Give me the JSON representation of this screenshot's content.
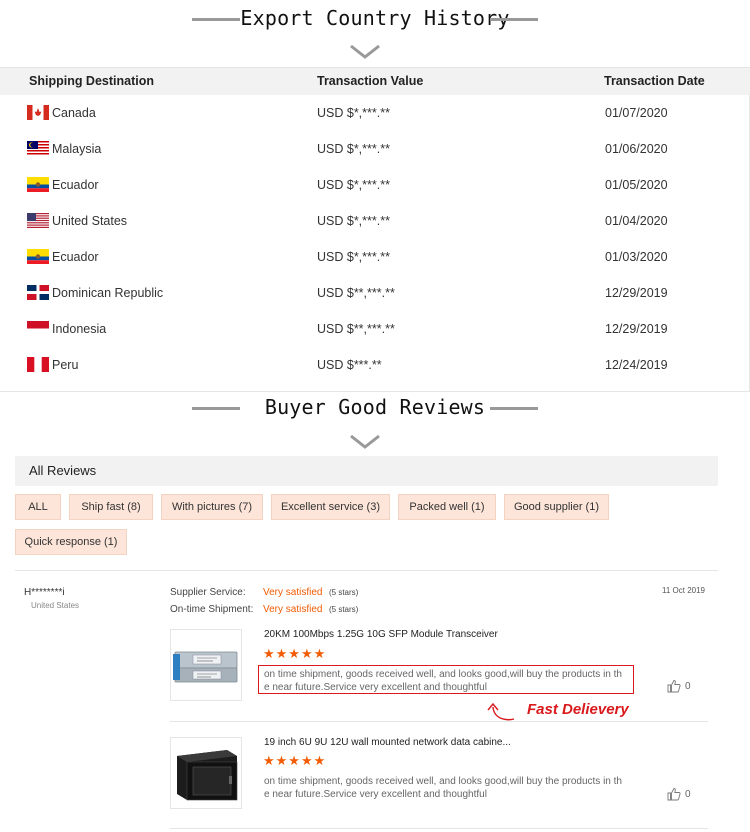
{
  "export_section": {
    "title": "Export Country History",
    "columns": [
      "Shipping Destination",
      "Transaction Value",
      "Transaction Date"
    ],
    "rows": [
      {
        "country": "Canada",
        "value": "USD $*,***.**",
        "date": "01/07/2020",
        "flag": "canada-flag"
      },
      {
        "country": "Malaysia",
        "value": "USD $*,***.**",
        "date": "01/06/2020",
        "flag": "malaysia-flag"
      },
      {
        "country": "Ecuador",
        "value": "USD $*,***.**",
        "date": "01/05/2020",
        "flag": "ecuador-flag"
      },
      {
        "country": "United States",
        "value": "USD $*,***.**",
        "date": "01/04/2020",
        "flag": "usa-flag"
      },
      {
        "country": "Ecuador",
        "value": "USD $*,***.**",
        "date": "01/03/2020",
        "flag": "ecuador-flag"
      },
      {
        "country": "Dominican Republic",
        "value": "USD $**,***.**",
        "date": "12/29/2019",
        "flag": "dominican-republic-flag"
      },
      {
        "country": "Indonesia",
        "value": "USD $**,***.**",
        "date": "12/29/2019",
        "flag": "indonesia-flag"
      },
      {
        "country": "Peru",
        "value": "USD $***.**",
        "date": "12/24/2019",
        "flag": "peru-flag"
      }
    ]
  },
  "reviews_section": {
    "title": "Buyer Good Reviews",
    "all_reviews_label": "All Reviews",
    "filters": [
      "ALL",
      "Ship fast (8)",
      "With pictures (7)",
      "Excellent service (3)",
      "Packed well (1)",
      "Good supplier (1)",
      "Quick response (1)"
    ],
    "review": {
      "buyer": "H********i",
      "location": "United States",
      "date": "11 Oct 2019",
      "supplier_service_label": "Supplier Service:",
      "supplier_service_value": "Very satisfied",
      "supplier_service_stars": "(5 stars)",
      "ontime_label": "On-time Shipment:",
      "ontime_value": "Very satisfied",
      "ontime_stars": "(5 stars)",
      "products": [
        {
          "title": "20KM 100Mbps 1.25G 10G SFP Module Transceiver",
          "stars": "★★★★★",
          "text_line1": "on time shipment, goods received well, and looks good,will buy the products in th",
          "text_line2": "e near future.Service very excellent and thoughtful",
          "likes": "0"
        },
        {
          "title": "19 inch 6U 9U 12U wall mounted network data cabine...",
          "stars": "★★★★★",
          "text_line1": "on time shipment, goods received well, and looks good,will buy the products in th",
          "text_line2": "e near future.Service very excellent and thoughtful",
          "likes": "0"
        }
      ],
      "annotation": "Fast Delievery"
    }
  },
  "colors": {
    "accent": "#f25c05",
    "tag_bg": "#fde5d9",
    "highlight_border": "#d9191c"
  }
}
